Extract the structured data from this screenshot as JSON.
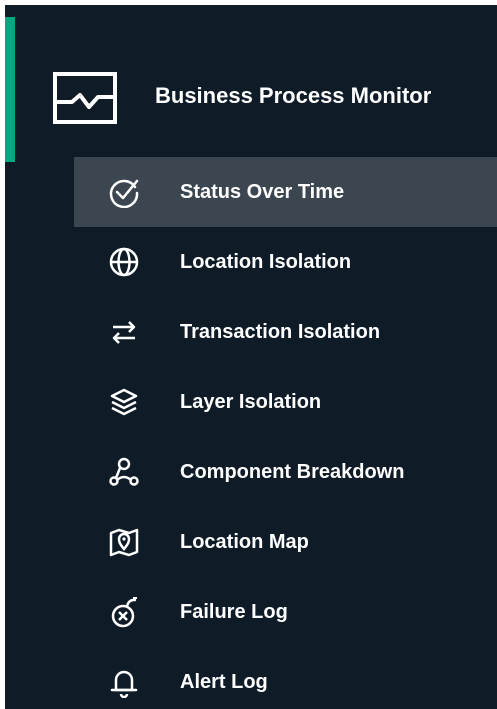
{
  "header": {
    "title": "Business Process Monitor",
    "icon": "monitor-chart-icon",
    "accent_color": "#01a982"
  },
  "nav": {
    "selected_index": 0,
    "items": [
      {
        "label": "Status Over Time",
        "icon": "status-check-icon"
      },
      {
        "label": "Location Isolation",
        "icon": "globe-icon"
      },
      {
        "label": "Transaction Isolation",
        "icon": "transfer-arrows-icon"
      },
      {
        "label": "Layer Isolation",
        "icon": "layers-icon"
      },
      {
        "label": "Component Breakdown",
        "icon": "cluster-icon"
      },
      {
        "label": "Location Map",
        "icon": "map-location-icon"
      },
      {
        "label": "Failure Log",
        "icon": "bomb-icon"
      },
      {
        "label": "Alert Log",
        "icon": "bell-icon"
      }
    ]
  },
  "colors": {
    "background": "#0f1c28",
    "selected_background": "#3c4650",
    "text": "#ffffff"
  }
}
